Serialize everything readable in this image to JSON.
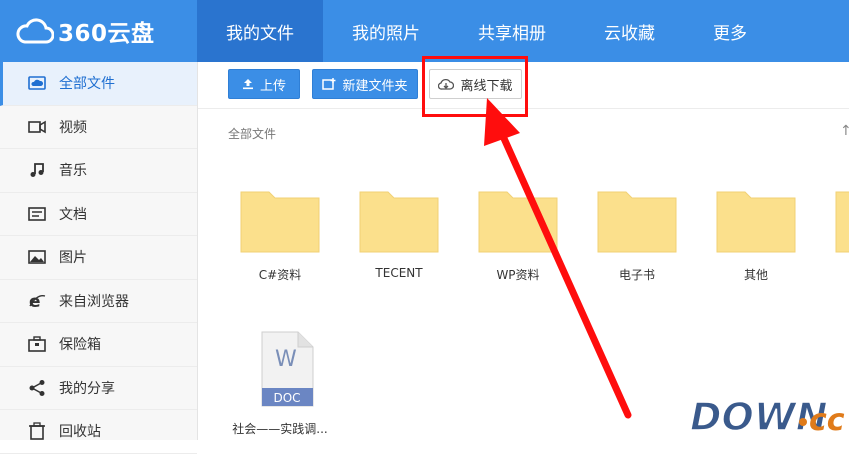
{
  "brand": {
    "name": "360云盘"
  },
  "nav": {
    "items": [
      {
        "label": "我的文件"
      },
      {
        "label": "我的照片"
      },
      {
        "label": "共享相册"
      },
      {
        "label": "云收藏"
      },
      {
        "label": "更多"
      }
    ]
  },
  "sidebar": {
    "items": [
      {
        "label": "全部文件",
        "icon": "cloud-icon"
      },
      {
        "label": "视频",
        "icon": "video-icon"
      },
      {
        "label": "音乐",
        "icon": "music-icon"
      },
      {
        "label": "文档",
        "icon": "document-icon"
      },
      {
        "label": "图片",
        "icon": "image-icon"
      },
      {
        "label": "来自浏览器",
        "icon": "browser-icon"
      },
      {
        "label": "保险箱",
        "icon": "safe-icon"
      },
      {
        "label": "我的分享",
        "icon": "share-icon"
      },
      {
        "label": "回收站",
        "icon": "trash-icon"
      }
    ]
  },
  "toolbar": {
    "upload_label": "上传",
    "new_folder_label": "新建文件夹",
    "offline_download_label": "离线下载"
  },
  "breadcrumb": {
    "label": "全部文件"
  },
  "files": [
    {
      "name": "C#资料",
      "type": "folder"
    },
    {
      "name": "TECENT",
      "type": "folder"
    },
    {
      "name": "WP资料",
      "type": "folder"
    },
    {
      "name": "电子书",
      "type": "folder"
    },
    {
      "name": "其他",
      "type": "folder"
    },
    {
      "name": "社会——实践调...",
      "type": "doc",
      "ext": "DOC"
    }
  ],
  "watermark": {
    "text_main": "DOWN",
    "text_cc": "cc"
  },
  "colors": {
    "accent": "#3b8ee6",
    "nav_active": "#2a74cf",
    "highlight": "#ff0d0d",
    "folder": "#fbe08c"
  }
}
